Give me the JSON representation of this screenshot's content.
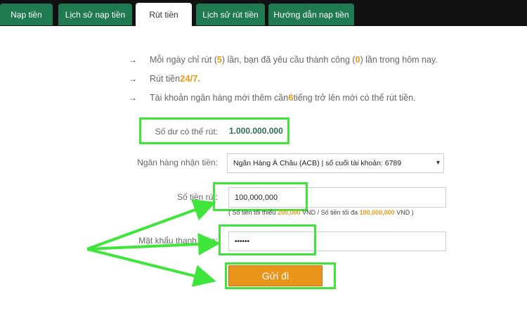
{
  "tabs": [
    {
      "label": "Nạp tiền",
      "active": false
    },
    {
      "label": "Lịch sử nạp tiền",
      "active": false
    },
    {
      "label": "Rút tiền",
      "active": true
    },
    {
      "label": "Lịch sử rút tiền",
      "active": false
    },
    {
      "label": "Hướng dẫn nạp tiền",
      "active": false
    }
  ],
  "notes": {
    "n1_a": "Mỗi ngày chỉ rút (",
    "n1_b": "5",
    "n1_c": ") lần, bạn đã yêu cầu thành công (",
    "n1_d": "0",
    "n1_e": ") lần trong hôm nay.",
    "n2_a": "Rút tiền ",
    "n2_b": "24/7.",
    "n3_a": "Tài khoản ngân hàng mới thêm cần ",
    "n3_b": "6",
    "n3_c": " tiếng trở lên mới có thể rút tiền.",
    "arrow": "→"
  },
  "form": {
    "balance_label": "Số dư có thể rút:",
    "balance_value": "1.000.000.000",
    "bank_label": "Ngân hàng nhận tiền:",
    "bank_value": "Ngân Hàng Á Châu (ACB) | số cuối tài khoản:  6789",
    "amount_label": "Số tiền rút:",
    "amount_value": "100,000,000",
    "hint_a": "( Số tiền tối thiểu ",
    "hint_min": "200,000",
    "hint_b": " VND / Số tiền tối đa ",
    "hint_max": "100,000,000",
    "hint_c": " VND )",
    "password_label": "Mật khẩu thanh toán:",
    "password_value": "••••••",
    "submit_label": "Gửi đi",
    "dropdown_caret": "▾"
  },
  "colors": {
    "tab_bg": "#1f7a52",
    "highlight": "#e39b16",
    "annotation_green": "#3fe53a",
    "button": "#e9951b"
  }
}
